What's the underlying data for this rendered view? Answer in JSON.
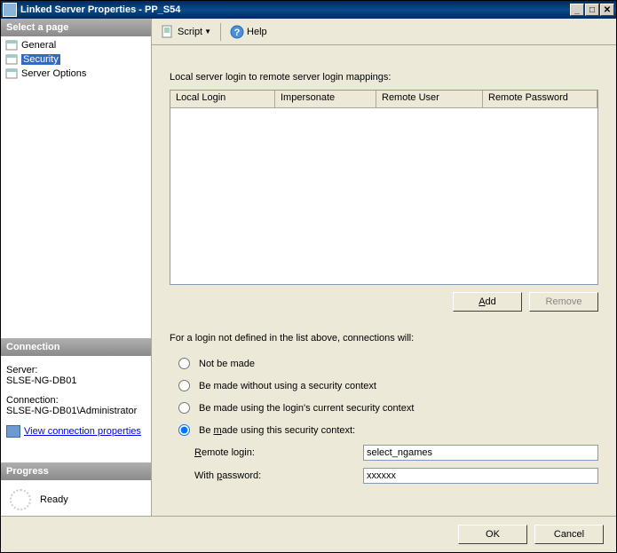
{
  "window": {
    "title": "Linked Server Properties - PP_S54"
  },
  "sidebar": {
    "select_page": "Select a page",
    "pages": [
      {
        "label": "General",
        "selected": false
      },
      {
        "label": "Security",
        "selected": true
      },
      {
        "label": "Server Options",
        "selected": false
      }
    ],
    "connection_header": "Connection",
    "server_label": "Server:",
    "server_value": "SLSE-NG-DB01",
    "connection_label": "Connection:",
    "connection_value": "SLSE-NG-DB01\\Administrator",
    "view_props": "View connection properties",
    "progress_header": "Progress",
    "progress_status": "Ready"
  },
  "toolbar": {
    "script": "Script",
    "help": "Help"
  },
  "main": {
    "mappings_label": "Local server login to remote server login mappings:",
    "columns": {
      "c1": "Local Login",
      "c2": "Impersonate",
      "c3": "Remote User",
      "c4": "Remote Password"
    },
    "add_btn": "Add",
    "remove_btn": "Remove",
    "undefined_desc": "For a login not defined in the list above, connections will:",
    "opt1": "Not be made",
    "opt2": "Be made without using a security context",
    "opt3": "Be made using the login's current security context",
    "opt4": "Be made using this security context:",
    "remote_login_label": "Remote login:",
    "remote_login_value": "select_ngames",
    "with_password_label": "With password:",
    "with_password_value": "xxxxxx"
  },
  "footer": {
    "ok": "OK",
    "cancel": "Cancel"
  }
}
